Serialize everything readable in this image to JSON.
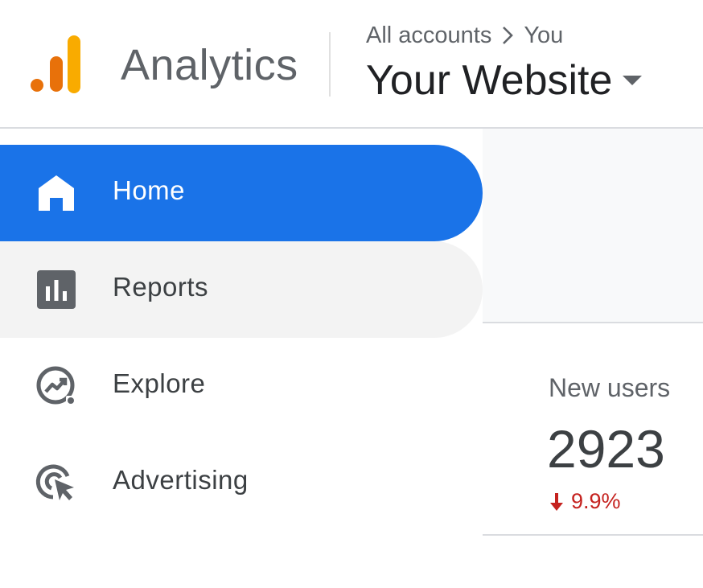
{
  "header": {
    "app_name": "Analytics",
    "breadcrumb": {
      "account": "All accounts",
      "separator_icon": "chevron-right-icon",
      "property": "You"
    },
    "property_selector": {
      "label": "Your Website",
      "icon": "caret-down-icon"
    },
    "logo_colors": [
      "#e8710a",
      "#f9ab00",
      "#fbbc04"
    ]
  },
  "sidebar": {
    "items": [
      {
        "label": "Home",
        "icon": "home-icon",
        "state": "active"
      },
      {
        "label": "Reports",
        "icon": "reports-icon",
        "state": "hover"
      },
      {
        "label": "Explore",
        "icon": "explore-icon",
        "state": "default"
      },
      {
        "label": "Advertising",
        "icon": "advertising-icon",
        "state": "default"
      }
    ],
    "active_color": "#1a73e8"
  },
  "main": {
    "metric": {
      "label": "New users",
      "value": "2923",
      "change": "9.9%",
      "change_direction": "down",
      "change_color": "#c5221f"
    }
  }
}
